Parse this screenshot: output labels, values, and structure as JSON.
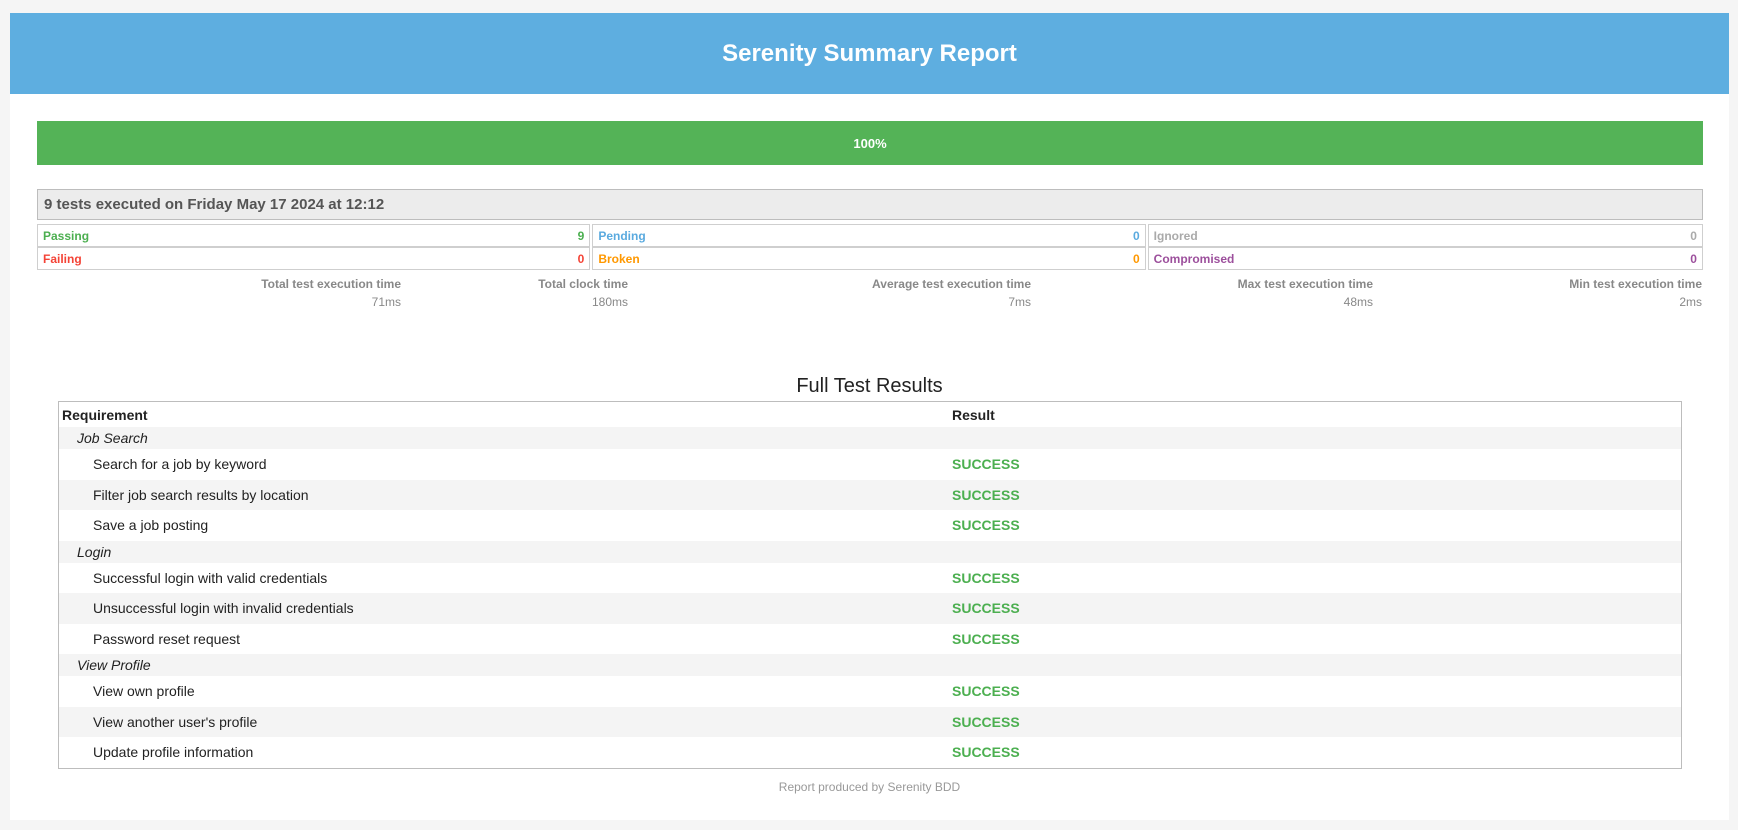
{
  "header": {
    "title": "Serenity Summary Report"
  },
  "progress": {
    "label": "100%",
    "value": 100,
    "color": "#54b357"
  },
  "summary": {
    "heading": "9 tests executed on Friday May 17 2024 at 12:12"
  },
  "counts": [
    {
      "label": "Passing",
      "value": "9",
      "color": "#4caf50"
    },
    {
      "label": "Pending",
      "value": "0",
      "color": "#5aaadf"
    },
    {
      "label": "Ignored",
      "value": "0",
      "color": "#aaaaaa"
    },
    {
      "label": "Failing",
      "value": "0",
      "color": "#f44336"
    },
    {
      "label": "Broken",
      "value": "0",
      "color": "#ff9800"
    },
    {
      "label": "Compromised",
      "value": "0",
      "color": "#9c4f9c"
    }
  ],
  "timings": [
    {
      "label": "Total test execution time",
      "value": "71ms"
    },
    {
      "label": "Total clock time",
      "value": "180ms"
    },
    {
      "label": "Average test execution time",
      "value": "7ms"
    },
    {
      "label": "Max test execution time",
      "value": "48ms"
    },
    {
      "label": "Min test execution time",
      "value": "2ms"
    }
  ],
  "results": {
    "title": "Full Test Results",
    "columns": {
      "requirement": "Requirement",
      "result": "Result"
    },
    "groups": [
      {
        "name": "Job Search",
        "tests": [
          {
            "name": "Search for a job by keyword",
            "result": "SUCCESS"
          },
          {
            "name": "Filter job search results by location",
            "result": "SUCCESS"
          },
          {
            "name": "Save a job posting",
            "result": "SUCCESS"
          }
        ]
      },
      {
        "name": "Login",
        "tests": [
          {
            "name": "Successful login with valid credentials",
            "result": "SUCCESS"
          },
          {
            "name": "Unsuccessful login with invalid credentials",
            "result": "SUCCESS"
          },
          {
            "name": "Password reset request",
            "result": "SUCCESS"
          }
        ]
      },
      {
        "name": "View Profile",
        "tests": [
          {
            "name": "View own profile",
            "result": "SUCCESS"
          },
          {
            "name": "View another user's profile",
            "result": "SUCCESS"
          },
          {
            "name": "Update profile information",
            "result": "SUCCESS"
          }
        ]
      }
    ]
  },
  "footer": {
    "text": "Report produced by Serenity BDD"
  }
}
